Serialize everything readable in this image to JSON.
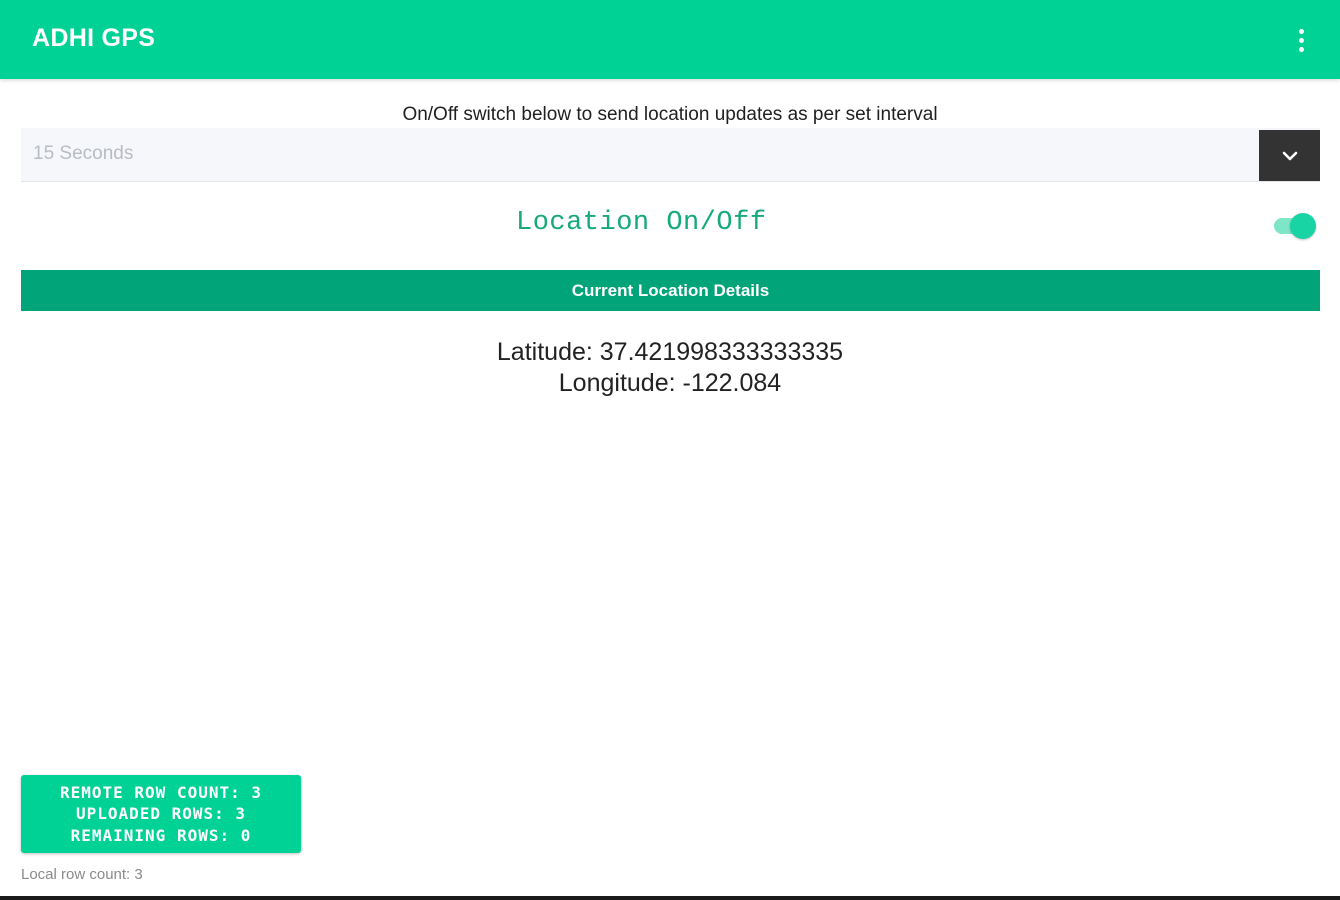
{
  "app": {
    "title": "ADHI GPS",
    "overflow_icon": "more-vertical-icon",
    "accent_color": "#00d195",
    "header_color": "#00a478"
  },
  "interval": {
    "instruction": "On/Off switch below to send location updates as per set interval",
    "selected": "15 Seconds",
    "dropdown_icon": "chevron-down-icon"
  },
  "location_toggle": {
    "label": "Location On/Off",
    "state": "on"
  },
  "details": {
    "header": "Current Location Details",
    "latitude": "Latitude: 37.421998333333335",
    "longitude": "Longitude: -122.084"
  },
  "counts": {
    "remote": "REMOTE ROW COUNT: 3",
    "uploaded": "UPLOADED ROWS: 3",
    "remaining": "REMAINING ROWS: 0",
    "local": "Local row count: 3"
  }
}
